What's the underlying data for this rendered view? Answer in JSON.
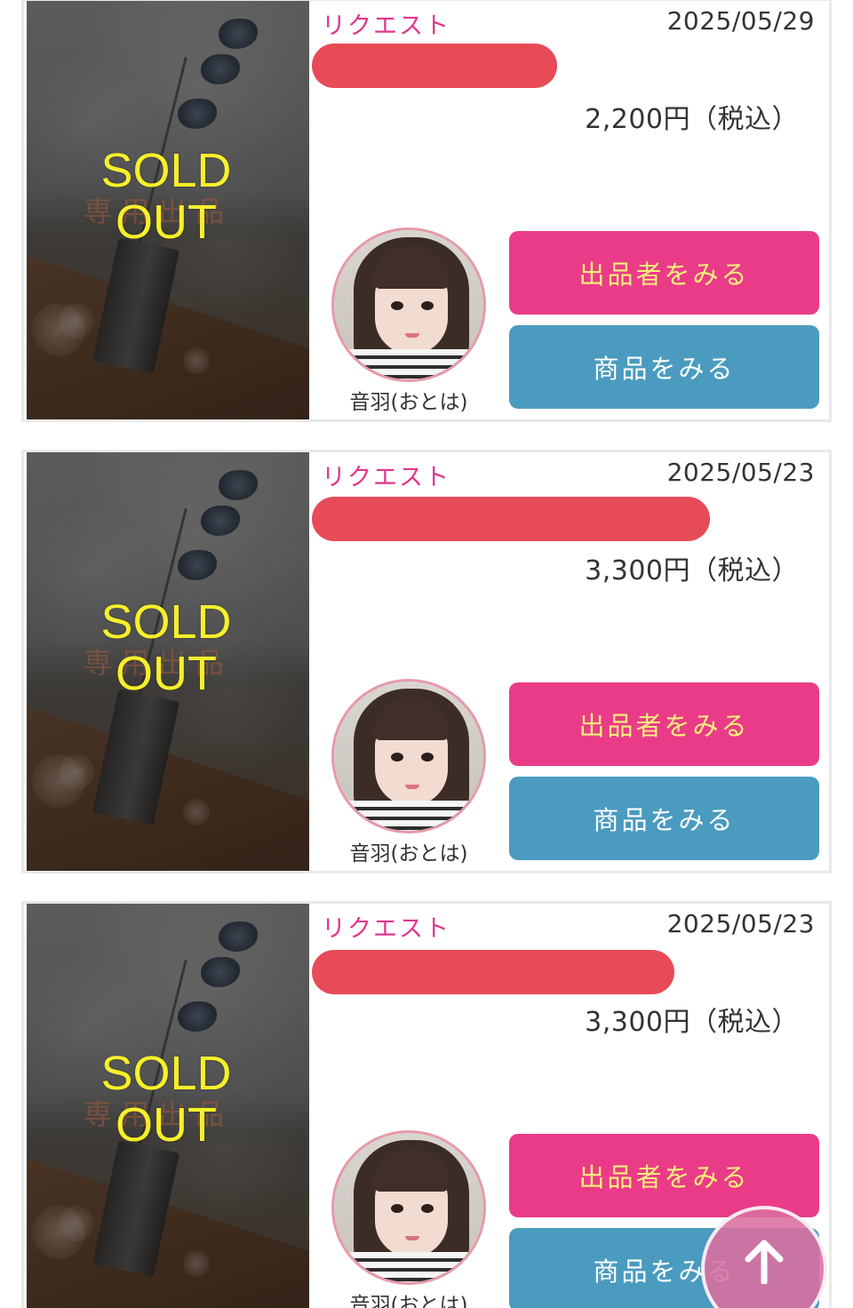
{
  "listings": [
    {
      "sold_badge": "SOLD OUT",
      "watermark_text": "専用出品",
      "tag": "リクエスト",
      "date": "2025/05/29",
      "title": "",
      "price": "2,200円（税込）",
      "seller_name": "音羽(おとは)",
      "seller_button": "出品者をみる",
      "item_button": "商品をみる"
    },
    {
      "sold_badge": "SOLD OUT",
      "watermark_text": "専用出品",
      "tag": "リクエスト",
      "date": "2025/05/23",
      "title": "",
      "price": "3,300円（税込）",
      "seller_name": "音羽(おとは)",
      "seller_button": "出品者をみる",
      "item_button": "商品をみる"
    },
    {
      "sold_badge": "SOLD OUT",
      "watermark_text": "専用出品",
      "tag": "リクエスト",
      "date": "2025/05/23",
      "title": "",
      "price": "3,300円（税込）",
      "seller_name": "音羽(おとは)",
      "seller_button": "出品者をみる",
      "item_button": "商品をみる"
    }
  ],
  "scroll_top_icon": "arrow-up-icon",
  "colors": {
    "tag": "#e2348c",
    "seller_button_bg": "#ea3b89",
    "seller_button_text": "#f5f07a",
    "item_button_bg": "#4a9bbf",
    "sold_text": "#f6f02a",
    "redaction": "#e74b57",
    "scroll_top_bg": "#dc6ea0"
  }
}
